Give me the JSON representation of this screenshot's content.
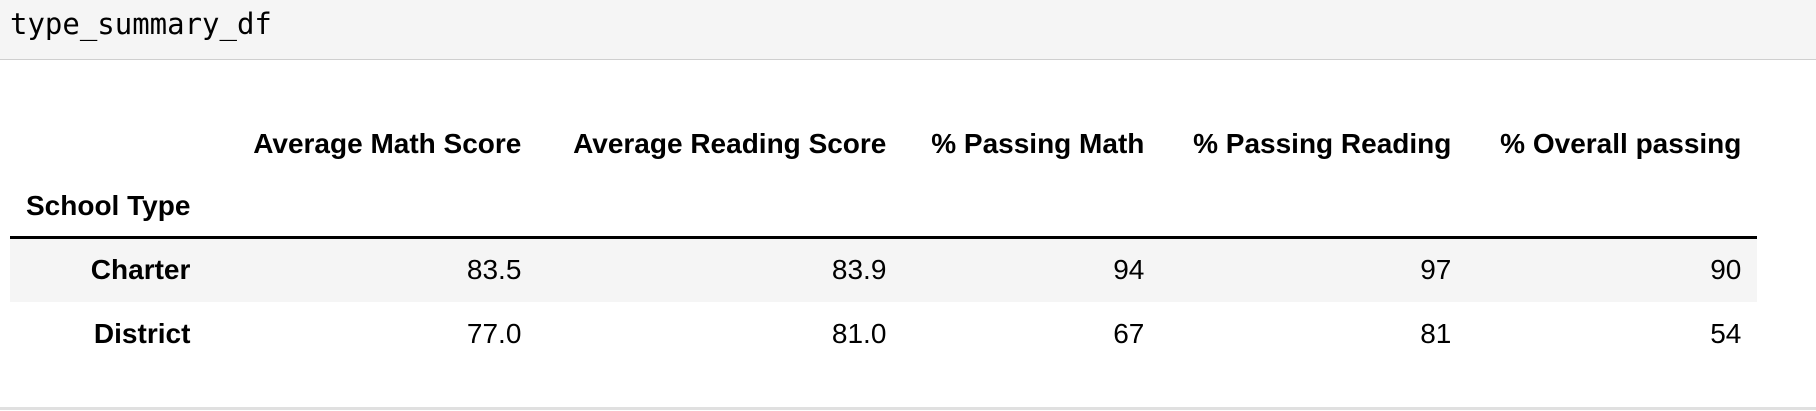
{
  "input_cell": {
    "code": "type_summary_df"
  },
  "dataframe": {
    "index_name": "School Type",
    "columns": [
      "Average Math Score",
      "Average Reading Score",
      "% Passing Math",
      "% Passing Reading",
      "% Overall passing"
    ],
    "rows": [
      {
        "index": "Charter",
        "values": [
          "83.5",
          "83.9",
          "94",
          "97",
          "90"
        ]
      },
      {
        "index": "District",
        "values": [
          "77.0",
          "81.0",
          "67",
          "81",
          "54"
        ]
      }
    ]
  }
}
